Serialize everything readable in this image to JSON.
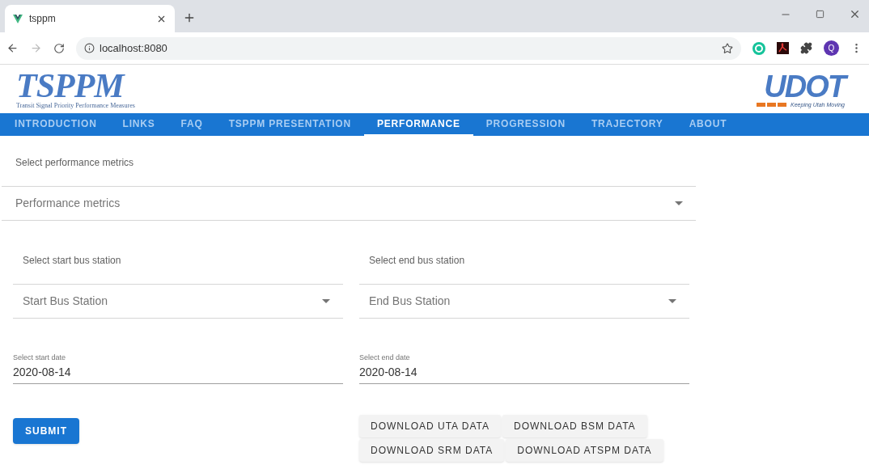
{
  "browser": {
    "tab_title": "tsppm",
    "address": "localhost:8080",
    "profile_initial": "Q"
  },
  "header": {
    "logo_title": "TSPPM",
    "logo_subtitle": "Transit Signal Priority Performance Measures",
    "partner_logo": "UDOT",
    "partner_tagline": "Keeping Utah Moving"
  },
  "nav": [
    {
      "label": "INTRODUCTION",
      "selected": false
    },
    {
      "label": "LINKS",
      "selected": false
    },
    {
      "label": "FAQ",
      "selected": false
    },
    {
      "label": "TSPPM PRESENTATION",
      "selected": false
    },
    {
      "label": "PERFORMANCE",
      "selected": true
    },
    {
      "label": "PROGRESSION",
      "selected": false
    },
    {
      "label": "TRAJECTORY",
      "selected": false
    },
    {
      "label": "ABOUT",
      "selected": false
    }
  ],
  "metrics": {
    "label": "Select performance metrics",
    "placeholder": "Performance metrics"
  },
  "stations": [
    {
      "label": "Select start bus station",
      "placeholder": "Start Bus Station"
    },
    {
      "label": "Select end bus station",
      "placeholder": "End Bus Station"
    }
  ],
  "dates": [
    {
      "label": "Select start date",
      "value": "2020-08-14"
    },
    {
      "label": "Select end date",
      "value": "2020-08-14"
    }
  ],
  "submit": "SUBMIT",
  "downloads": [
    [
      "DOWNLOAD UTA DATA",
      "DOWNLOAD BSM DATA"
    ],
    [
      "DOWNLOAD SRM DATA",
      "DOWNLOAD ATSPM DATA"
    ]
  ]
}
